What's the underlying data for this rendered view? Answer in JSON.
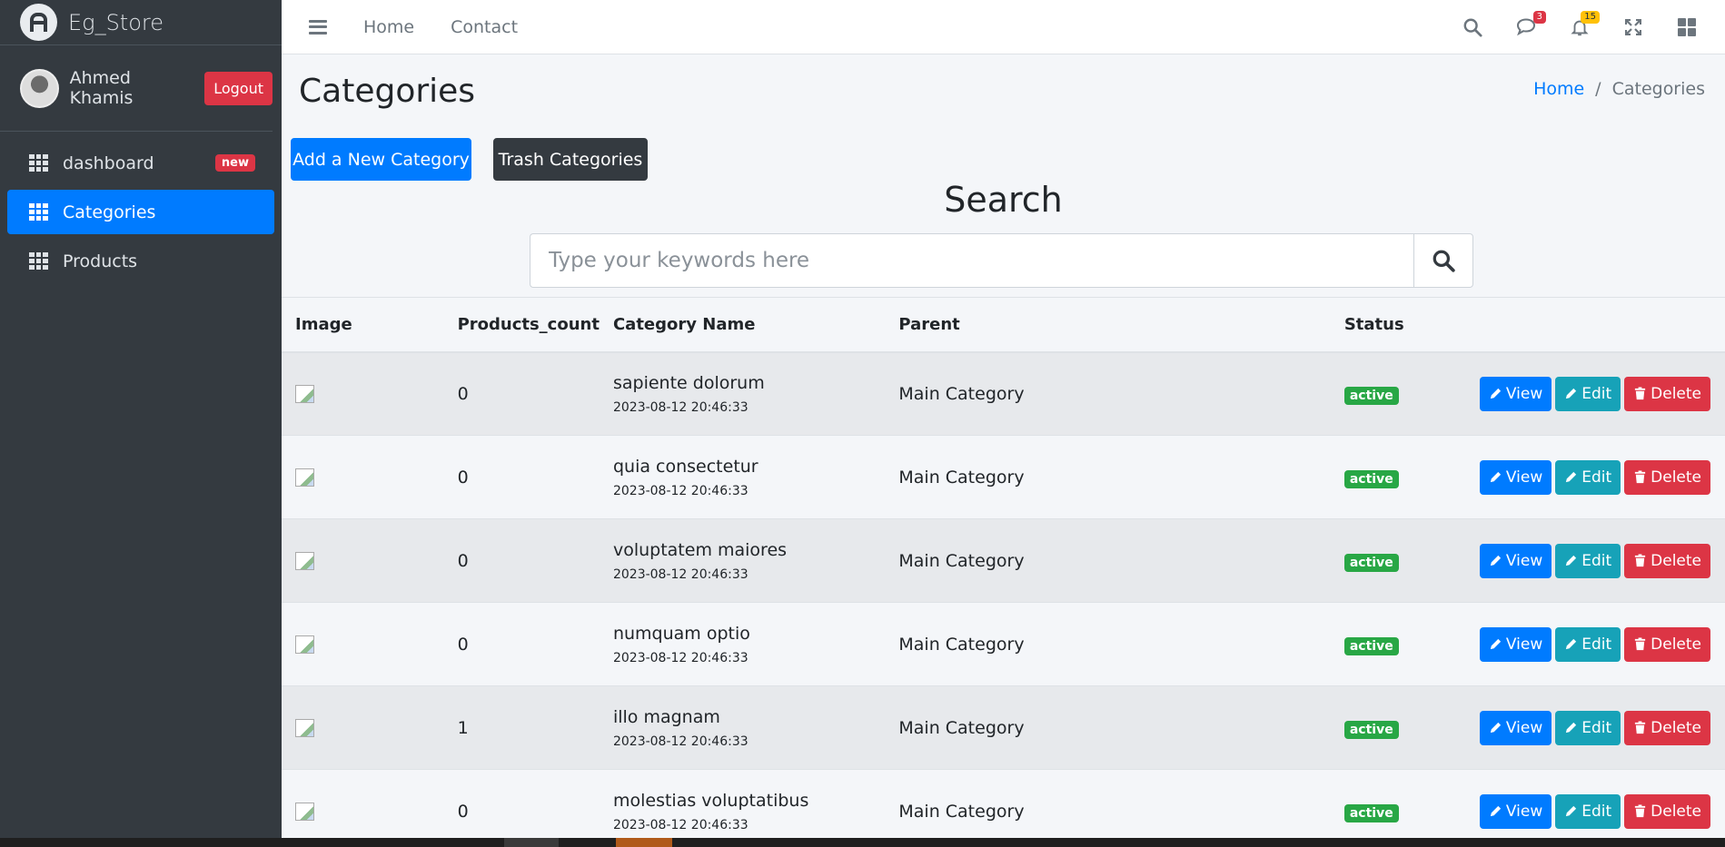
{
  "brand": {
    "name": "Eg_Store"
  },
  "user": {
    "name": "Ahmed Khamis",
    "logout_label": "Logout"
  },
  "sidebar": {
    "items": [
      {
        "label": "dashboard",
        "badge": "new"
      },
      {
        "label": "Categories"
      },
      {
        "label": "Products"
      }
    ]
  },
  "topnav": {
    "links": [
      "Home",
      "Contact"
    ],
    "messages_count": "3",
    "notifications_count": "15",
    "icons": [
      "search-icon",
      "chat-icon",
      "bell-icon",
      "expand-icon",
      "apps-grid-icon"
    ]
  },
  "page": {
    "title": "Categories",
    "breadcrumb": {
      "home": "Home",
      "current": "Categories"
    },
    "add_button": "Add a New Category",
    "trash_button": "Trash Categories",
    "search_title": "Search",
    "search_placeholder": "Type your keywords here"
  },
  "table": {
    "headers": [
      "Image",
      "Products_count",
      "Category Name",
      "Parent",
      "Status",
      ""
    ],
    "rows": [
      {
        "count": "0",
        "name": "sapiente dolorum",
        "date": "2023-08-12 20:46:33",
        "parent": "Main Category",
        "status": "active"
      },
      {
        "count": "0",
        "name": "quia consectetur",
        "date": "2023-08-12 20:46:33",
        "parent": "Main Category",
        "status": "active"
      },
      {
        "count": "0",
        "name": "voluptatem maiores",
        "date": "2023-08-12 20:46:33",
        "parent": "Main Category",
        "status": "active"
      },
      {
        "count": "0",
        "name": "numquam optio",
        "date": "2023-08-12 20:46:33",
        "parent": "Main Category",
        "status": "active"
      },
      {
        "count": "1",
        "name": "illo magnam",
        "date": "2023-08-12 20:46:33",
        "parent": "Main Category",
        "status": "active"
      },
      {
        "count": "0",
        "name": "molestias voluptatibus",
        "date": "2023-08-12 20:46:33",
        "parent": "Main Category",
        "status": "active"
      }
    ],
    "actions": {
      "view": "View",
      "edit": "Edit",
      "delete": "Delete"
    }
  },
  "colors": {
    "primary": "#007bff",
    "info": "#17a2b8",
    "danger": "#dc3545",
    "success": "#28a745",
    "sidebar": "#343a40"
  }
}
